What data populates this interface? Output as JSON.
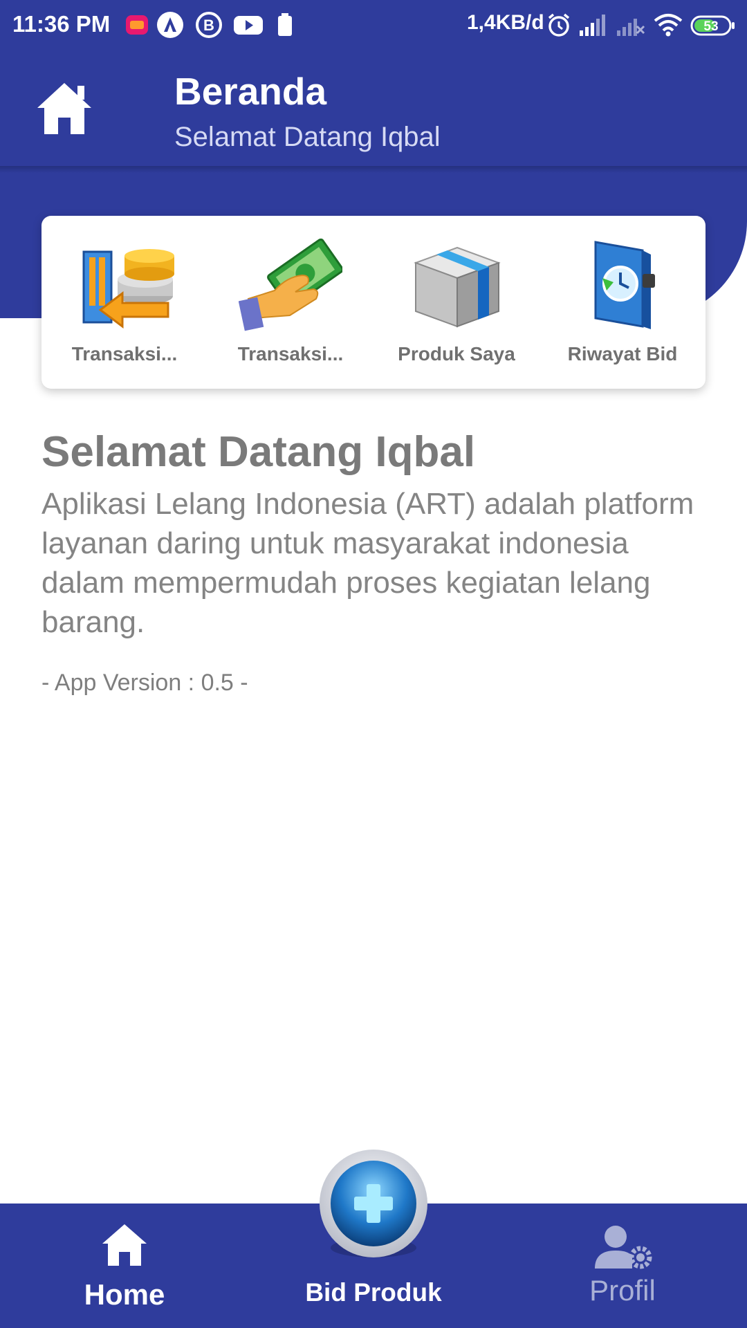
{
  "status_bar": {
    "time": "11:36 PM",
    "netspeed": "1,4KB/d",
    "battery": "53",
    "icons": [
      "lazada-icon",
      "a-app-icon",
      "b-app-icon",
      "youtube-icon",
      "battery-saver-icon",
      "alarm-icon",
      "signal-icon",
      "signal-no-sim-icon",
      "wifi-icon",
      "battery-icon"
    ]
  },
  "header": {
    "title": "Beranda",
    "subtitle": "Selamat Datang Iqbal",
    "icon": "home-icon"
  },
  "menu": {
    "items": [
      {
        "label": "Transaksi...",
        "icon": "transaction-coins-icon"
      },
      {
        "label": "Transaksi...",
        "icon": "money-hand-icon"
      },
      {
        "label": "Produk Saya",
        "icon": "product-box-icon"
      },
      {
        "label": "Riwayat Bid",
        "icon": "history-book-icon"
      }
    ]
  },
  "welcome": {
    "title": "Selamat Datang Iqbal",
    "description": "Aplikasi Lelang Indonesia (ART) adalah platform layanan daring untuk masyarakat indonesia dalam mempermudah proses kegiatan lelang barang.",
    "version": "- App Version : 0.5 -"
  },
  "bottom_nav": {
    "home": "Home",
    "bid": "Bid Produk",
    "profil": "Profil"
  },
  "colors": {
    "primary": "#2f3c9c",
    "text_muted": "#7a7a7a",
    "inactive_nav": "#a9b0d6"
  }
}
